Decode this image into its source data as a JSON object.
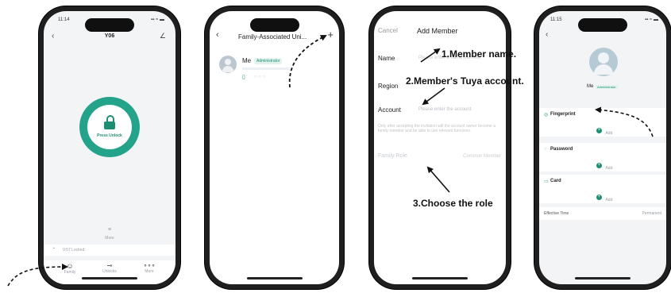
{
  "phone1": {
    "time": "11:14",
    "title": "Y06",
    "unlock_label": "Press Unlock",
    "more_small": "More",
    "record_text": "9:57 Locked",
    "tabs": [
      {
        "label": "Family",
        "icon": "user-icon"
      },
      {
        "label": "Unlocks",
        "icon": "key-icon"
      },
      {
        "label": "More",
        "icon": "more-dots-icon"
      }
    ]
  },
  "phone2": {
    "title": "Family-Associated Uni...",
    "member_name": "Me",
    "member_role": "Administrator"
  },
  "phone3": {
    "cancel": "Cancel",
    "title": "Add Member",
    "name_label": "Name",
    "name_placeholder": "Please enter a name member",
    "region_label": "Region",
    "account_label": "Account",
    "account_placeholder": "Please enter the account",
    "note": "Only after accepting the invitation will the account owner become a family member and be able to use relevant functions.",
    "role_label": "Family Role",
    "role_value": "Common Member"
  },
  "phone4": {
    "time": "11:15",
    "member_name": "Me",
    "member_role": "Administrator",
    "sections": [
      {
        "label": "Fingerprint",
        "add": "Add"
      },
      {
        "label": "Password",
        "add": "Add"
      },
      {
        "label": "Card",
        "add": "Add"
      }
    ],
    "effective_label": "Effective Time",
    "effective_value": "Permanent"
  },
  "annotations": {
    "step1": "1.Member name.",
    "step2": "2.Member's Tuya account.",
    "step3": "3.Choose the role"
  },
  "colors": {
    "accent": "#1e8e72",
    "ring": "#23a389"
  }
}
